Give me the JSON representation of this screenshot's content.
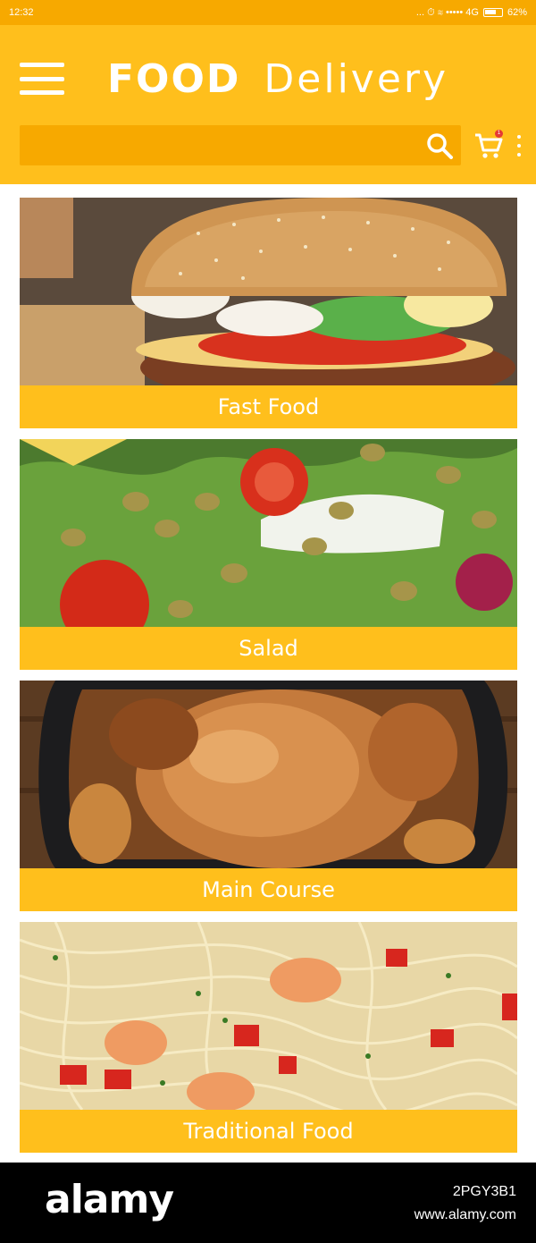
{
  "status_bar": {
    "time": "12:32",
    "indicators": "...  ⏱  ≋ ••••• 4G",
    "battery": "62%"
  },
  "header": {
    "brand_bold": "FOOD",
    "brand_light": "Delivery",
    "search": {
      "value": "",
      "placeholder": ""
    },
    "cart_badge": "1",
    "icons": [
      "menu-icon",
      "search-icon",
      "cart-icon",
      "more-vertical-icon"
    ]
  },
  "categories": [
    {
      "label": "Fast Food",
      "image": "burger"
    },
    {
      "label": "Salad",
      "image": "salad"
    },
    {
      "label": "Main Course",
      "image": "roast-chicken"
    },
    {
      "label": "Traditional Food",
      "image": "shrimp-pasta"
    }
  ],
  "colors": {
    "accent": "#ffbf1c",
    "accent_dark": "#f7a900",
    "text_on_accent": "#ffffff"
  },
  "watermark": {
    "logo": "alamy",
    "image_id": "2PGY3B1",
    "url": "www.alamy.com"
  }
}
